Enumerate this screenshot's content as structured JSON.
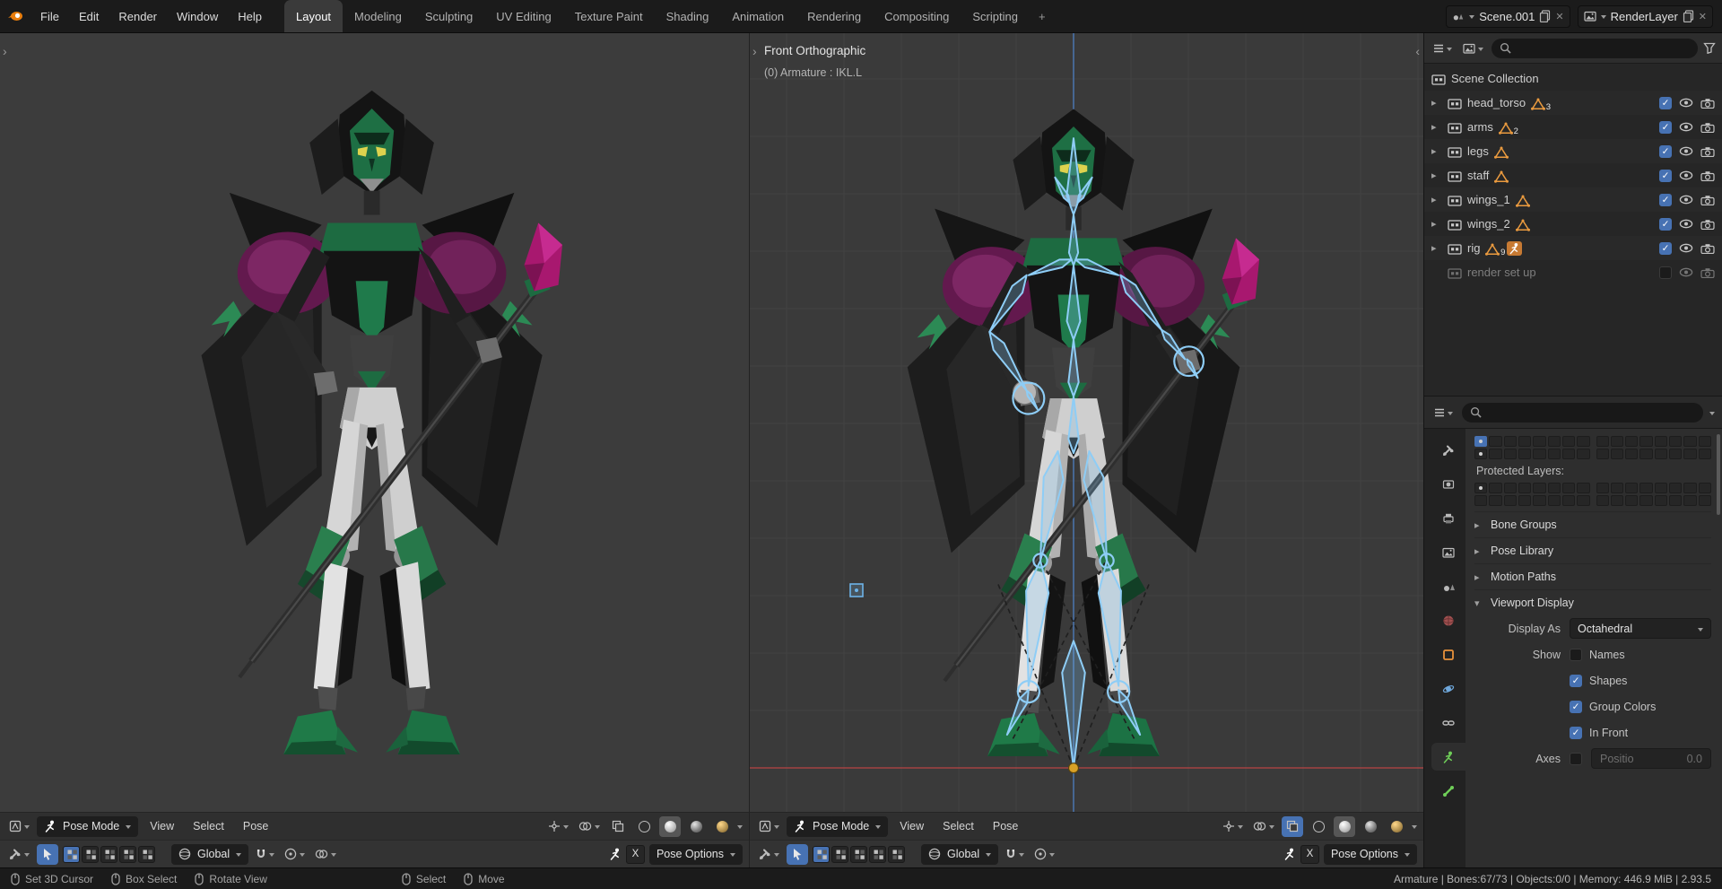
{
  "topbar": {
    "menus": [
      "File",
      "Edit",
      "Render",
      "Window",
      "Help"
    ],
    "tabs": [
      "Layout",
      "Modeling",
      "Sculpting",
      "UV Editing",
      "Texture Paint",
      "Shading",
      "Animation",
      "Rendering",
      "Compositing",
      "Scripting"
    ],
    "active_tab": "Layout",
    "add_tab_label": "+",
    "scene_name": "Scene.001",
    "view_layer_name": "RenderLayer"
  },
  "viewport": {
    "mode_label": "Pose Mode",
    "menu_view": "View",
    "menu_select": "Select",
    "menu_pose": "Pose",
    "orientation_label": "Global",
    "mirror_label": "X",
    "pose_options_label": "Pose Options"
  },
  "viewport_right": {
    "view_label": "Front Orthographic",
    "active_label": "(0) Armature : IKL.L"
  },
  "outliner": {
    "root_label": "Scene Collection",
    "items": [
      {
        "label": "head_torso",
        "badge": "3",
        "checked": true
      },
      {
        "label": "arms",
        "badge": "2",
        "checked": true
      },
      {
        "label": "legs",
        "badge": "",
        "checked": true
      },
      {
        "label": "staff",
        "badge": "",
        "checked": true
      },
      {
        "label": "wings_1",
        "badge": "",
        "checked": true
      },
      {
        "label": "wings_2",
        "badge": "",
        "checked": true
      },
      {
        "label": "rig",
        "badge": "9",
        "checked": true,
        "has_armature": true
      },
      {
        "label": "render set up",
        "badge": "",
        "checked": false,
        "disabled": true
      }
    ]
  },
  "properties": {
    "protected_layers_label": "Protected Layers:",
    "panels_collapsed": [
      "Bone Groups",
      "Pose Library",
      "Motion Paths"
    ],
    "viewport_display": {
      "title": "Viewport Display",
      "display_as_label": "Display As",
      "display_as_value": "Octahedral",
      "show_label": "Show",
      "options": [
        {
          "label": "Names",
          "checked": false
        },
        {
          "label": "Shapes",
          "checked": true
        },
        {
          "label": "Group Colors",
          "checked": true
        },
        {
          "label": "In Front",
          "checked": true
        }
      ],
      "axes_label": "Axes",
      "axes_checked": false,
      "position_label": "Positio",
      "position_value": "0.0"
    },
    "layer_grids": {
      "layers": {
        "active": [
          0
        ],
        "dot": [
          0,
          16
        ]
      },
      "protected": {
        "active": [],
        "dot": [
          0
        ]
      }
    }
  },
  "statusbar": {
    "hint_groups": [
      [
        "Set 3D Cursor",
        "Box Select",
        "Rotate View"
      ],
      [
        "Select",
        "Move"
      ]
    ],
    "info": "Armature | Bones:67/73 | Objects:0/0 | Memory: 446.9 MiB | 2.93.5"
  },
  "icons": {
    "search": "magnifier",
    "filter": "funnel",
    "eye": "eye-outline",
    "camera": "camera",
    "checkbox": "check-square",
    "collection": "box",
    "mesh-data": "orange-triangle",
    "armature-data": "running-figure",
    "disclosure-closed": "▸",
    "disclosure-open": "▾",
    "mouse-hint": "mouse",
    "snap": "magnet",
    "cursor-tool": "arrow"
  },
  "colors": {
    "accent": "#4772b3",
    "bone_overlay": "#8ecdf6",
    "mesh_icon": "#eb9b3f",
    "crystal": "#a8186f"
  }
}
